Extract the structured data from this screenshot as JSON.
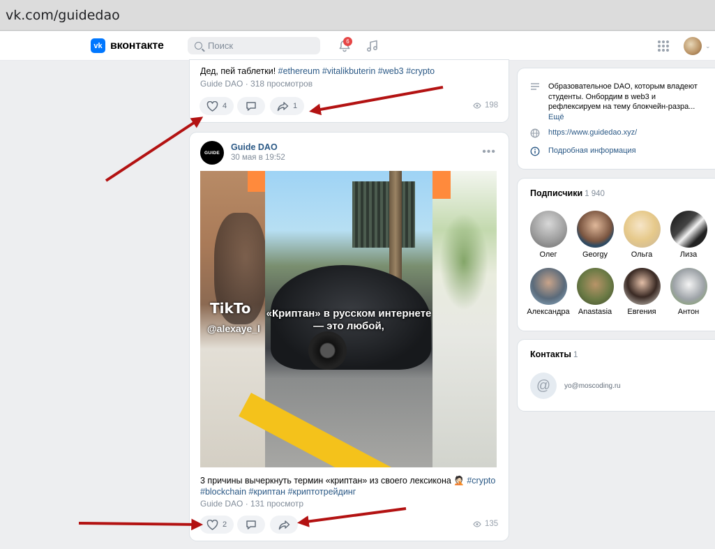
{
  "browser": {
    "url": "vk.com/guidedao"
  },
  "header": {
    "logo_text": "вконтакте",
    "logo_mark": "vk",
    "search_placeholder": "Поиск",
    "notifications_count": "6",
    "icons": [
      "search-icon",
      "bell-icon",
      "music-icon",
      "apps-grid-icon",
      "chevron-down-icon"
    ]
  },
  "post1": {
    "text_plain": "Дед, пей таблетки! ",
    "hashtags": "#ethereum #vitalikbuterin #web3 #crypto",
    "meta": "Guide DAO · 318 просмотров",
    "likes": "4",
    "shares": "1",
    "views": "198"
  },
  "post2": {
    "group_avatar_text": "GUIDE",
    "group_name": "Guide DAO",
    "date": "30 мая в 19:52",
    "more": "•••",
    "video": {
      "tiktok_logo": "TikTo",
      "tiktok_handle": "@alexaye_l",
      "caption": "«Криптан» в русском интернете — это любой,"
    },
    "text_plain": "3 причины вычеркнуть термин «криптан» из своего лексикона 🤦🏻 ",
    "hashtag_line1": "#crypto",
    "hashtag_line2": "#blockchain #криптан #криптотрейдинг",
    "meta": "Guide DAO · 131 просмотр",
    "likes": "2",
    "views": "135"
  },
  "info": {
    "description": "Образовательное DAO, которым владеют студенты. Онбордим в web3 и рефлексируем на тему блокчейн-разра...",
    "more_label": "Ещё",
    "website": "https://www.guidedao.xyz/",
    "details_label": "Подробная информация"
  },
  "subscribers": {
    "title": "Подписчики",
    "count": "1 940",
    "people": [
      {
        "name": "Олег"
      },
      {
        "name": "Georgy"
      },
      {
        "name": "Ольга"
      },
      {
        "name": "Лиза"
      },
      {
        "name": "Александра"
      },
      {
        "name": "Anastasia"
      },
      {
        "name": "Евгения"
      },
      {
        "name": "Антон"
      }
    ]
  },
  "contacts": {
    "title": "Контакты",
    "count": "1",
    "avatar_symbol": "@",
    "email": "yo@moscoding.ru"
  },
  "colors": {
    "accent": "#0077ff",
    "link": "#2a5885",
    "badge": "#e64646",
    "annotation_arrow": "#b31212"
  }
}
